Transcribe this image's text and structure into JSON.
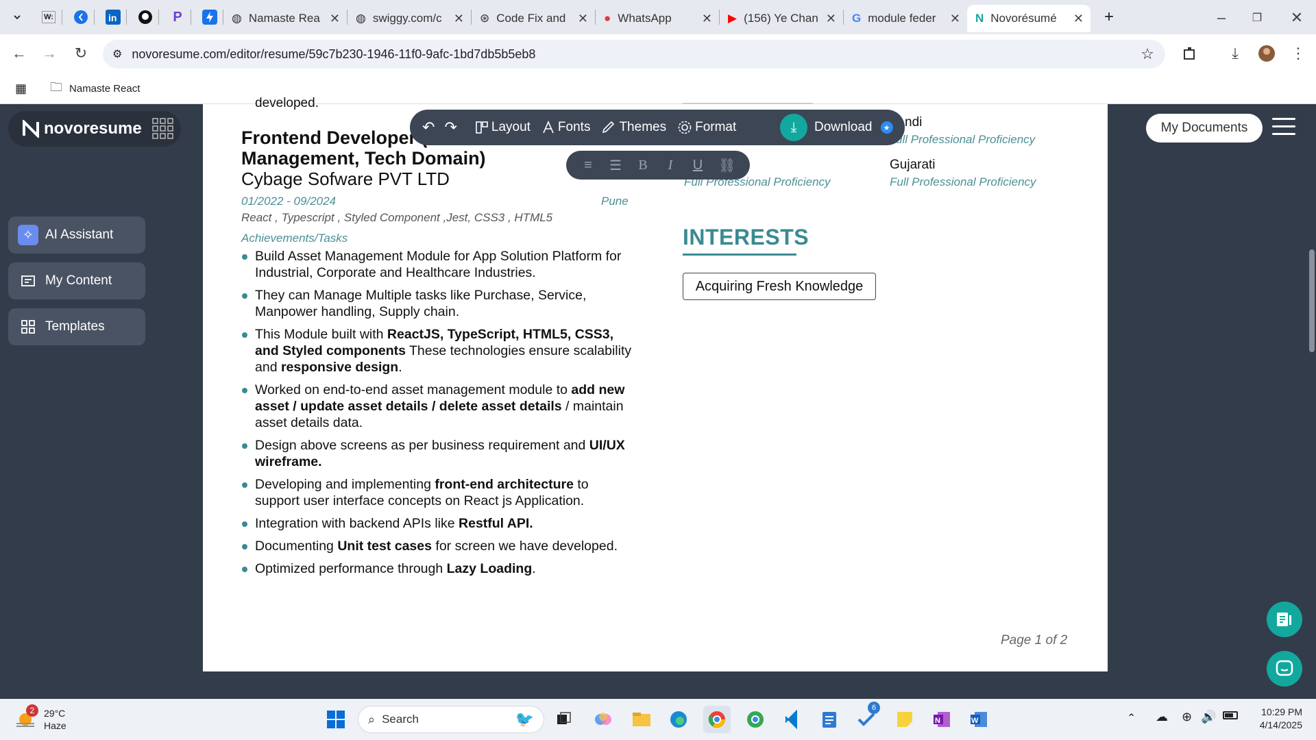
{
  "browser": {
    "tabs": [
      {
        "label": "Namaste Rea"
      },
      {
        "label": "swiggy.com/c"
      },
      {
        "label": "Code Fix and"
      },
      {
        "label": "WhatsApp"
      },
      {
        "label": "(156) Ye Chan"
      },
      {
        "label": "module feder"
      },
      {
        "label": "Novorésumé"
      }
    ],
    "url": "novoresume.com/editor/resume/59c7b230-1946-11f0-9afc-1bd7db5b5eb8",
    "bookmark": "Namaste React"
  },
  "app": {
    "logo": "novoresume",
    "sidebar": [
      {
        "label": "AI Assistant"
      },
      {
        "label": "My Content"
      },
      {
        "label": "Templates"
      }
    ],
    "toolbar": {
      "layout": "Layout",
      "fonts": "Fonts",
      "themes": "Themes",
      "format": "Format",
      "download": "Download"
    },
    "format_bar": {
      "bold": "B",
      "italic": "I",
      "underline": "U"
    },
    "my_documents": "My Documents"
  },
  "resume": {
    "top_fragment": "developed.",
    "job_title": "Frontend Developer (Asset Management, Tech Domain)",
    "company": "Cybage Sofware PVT LTD",
    "dates": "01/2022 - 09/2024",
    "location": "Pune",
    "tech": "React , Typescript , Styled Component ,Jest, CSS3 , HTML5",
    "achievements_label": "Achievements/Tasks",
    "languages": [
      {
        "name": "ndi",
        "level": "ull Professional Proficiency"
      },
      {
        "name": "Gujarati",
        "level": "Full Professional Proficiency"
      },
      {
        "level_left": "Full Professional Proficiency"
      }
    ],
    "interests_heading": "INTERESTS",
    "interest": "Acquiring Fresh Knowledge",
    "page_number": "Page 1 of 2"
  },
  "taskbar": {
    "weather_temp": "29°C",
    "weather_desc": "Haze",
    "weather_badge": "2",
    "search": "Search",
    "todo_badge": "6",
    "time": "10:29 PM",
    "date": "4/14/2025"
  }
}
